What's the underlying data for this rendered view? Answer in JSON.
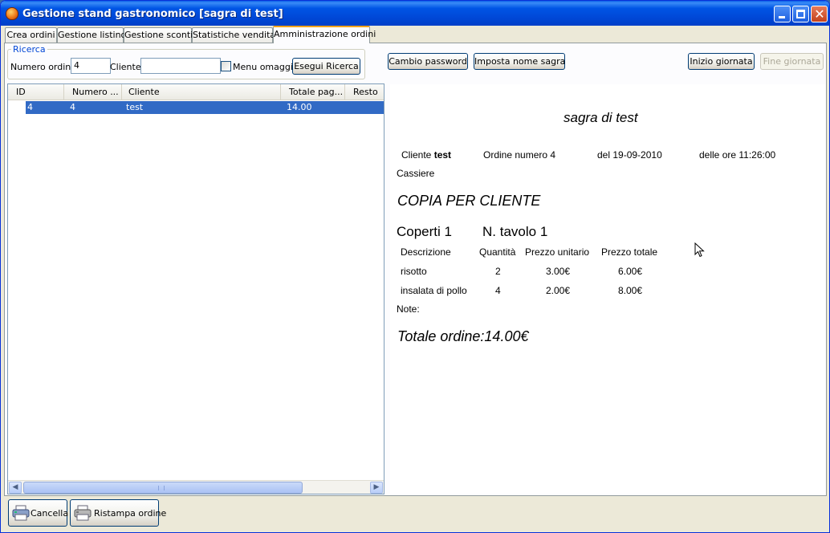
{
  "window": {
    "title": "Gestione stand gastronomico   [sagra di test]"
  },
  "tabs": [
    {
      "label": "Crea ordini"
    },
    {
      "label": "Gestione listino"
    },
    {
      "label": "Gestione sconti"
    },
    {
      "label": "Statistiche vendita"
    },
    {
      "label": "Amministrazione ordini",
      "active": true
    }
  ],
  "search": {
    "legend": "Ricerca",
    "order_number_label": "Numero ordine:",
    "order_number_value": "4",
    "client_label": "Cliente:",
    "client_value": "",
    "menu_omaggio_label": "Menu omaggio",
    "menu_omaggio_checked": false,
    "search_button": "Esegui Ricerca"
  },
  "toolbar": {
    "cambio_password": "Cambio password",
    "imposta_nome": "Imposta nome sagra",
    "inizio_giornata": "Inizio giornata",
    "fine_giornata": "Fine giornata"
  },
  "table": {
    "columns": [
      "ID",
      "Numero ...",
      "Cliente",
      "Totale pag...",
      "Resto"
    ],
    "rows": [
      {
        "id": "4",
        "numero": "4",
        "cliente": "test",
        "totale": "14.00",
        "resto": "",
        "selected": true
      }
    ]
  },
  "receipt": {
    "sagra_name": "sagra di test",
    "cliente_label": "Cliente",
    "cliente_value": "test",
    "ordine_label": "Ordine numero",
    "ordine_value": "4",
    "del_label": "del",
    "date": "19-09-2010",
    "ore_label": "delle ore",
    "time": "11:26:00",
    "cassiere_label": "Cassiere",
    "copy_label": "COPIA PER CLIENTE",
    "coperti_label": "Coperti",
    "coperti_value": "1",
    "tavolo_label": "N. tavolo",
    "tavolo_value": "1",
    "headers": [
      "Descrizione",
      "Quantità",
      "Prezzo unitario",
      "Prezzo totale"
    ],
    "items": [
      {
        "descrizione": "risotto",
        "quantita": "2",
        "unitario": "3.00€",
        "totale": "6.00€"
      },
      {
        "descrizione": "insalata di pollo",
        "quantita": "4",
        "unitario": "2.00€",
        "totale": "8.00€"
      }
    ],
    "note_label": "Note:",
    "totale_label": "Totale ordine:",
    "totale_value": "14.00€"
  },
  "bottom": {
    "cancella": "Cancella",
    "ristampa": "Ristampa ordine"
  },
  "icons": {
    "app": "app-icon",
    "cancella": "printer-delete-icon",
    "ristampa": "printer-icon"
  }
}
